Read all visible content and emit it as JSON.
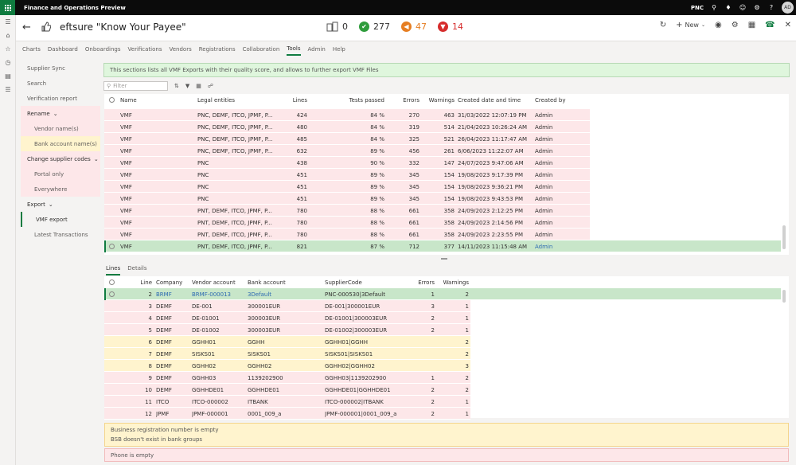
{
  "app": {
    "name": "Finance and Operations Preview",
    "company": "PNC",
    "user_initials": "AD"
  },
  "header": {
    "title": "eftsure \"Know Your Payee\"",
    "new_label": "New"
  },
  "stats": [
    {
      "value": "0",
      "color": "#666666"
    },
    {
      "value": "277",
      "color": "#2e9c3b"
    },
    {
      "value": "47",
      "color": "#e67e22"
    },
    {
      "value": "14",
      "color": "#d62c2c"
    }
  ],
  "tabs": [
    "Charts",
    "Dashboard",
    "Onboardings",
    "Verifications",
    "Vendors",
    "Registrations",
    "Collaboration",
    "Tools",
    "Admin",
    "Help"
  ],
  "active_tab": "Tools",
  "nav": [
    {
      "label": "Supplier Sync",
      "style": "plain"
    },
    {
      "label": "Search",
      "style": "plain"
    },
    {
      "label": "Verification report",
      "style": "plain"
    },
    {
      "label": "Rename",
      "style": "pink-hd"
    },
    {
      "label": "Vendor name(s)",
      "style": "pink-sub"
    },
    {
      "label": "Bank account name(s)",
      "style": "yellow-sub"
    },
    {
      "label": "Change supplier codes",
      "style": "pink-hd"
    },
    {
      "label": "Portal only",
      "style": "pink-sub"
    },
    {
      "label": "Everywhere",
      "style": "pink-sub"
    },
    {
      "label": "Export",
      "style": "hd"
    },
    {
      "label": "VMF export",
      "style": "sel"
    },
    {
      "label": "Latest Transactions",
      "style": "sub"
    }
  ],
  "banner": "This sections lists all VMF Exports with their quality score, and allows to further export VMF Files",
  "filter_placeholder": "Filter",
  "top_grid": {
    "headers": [
      "Name",
      "Legal entities",
      "Lines",
      "Tests passed",
      "Errors",
      "Warnings",
      "Created date and time",
      "Created by"
    ],
    "rows": [
      [
        "VMF",
        "PNC, DEMF, ITCO, JPMF, P...",
        "424",
        "84 %",
        "270",
        "463",
        "31/03/2022 12:07:19 PM",
        "Admin"
      ],
      [
        "VMF",
        "PNC, DEMF, ITCO, JPMF, P...",
        "480",
        "84 %",
        "319",
        "514",
        "21/04/2023 10:26:24 AM",
        "Admin"
      ],
      [
        "VMF",
        "PNC, DEMF, ITCO, JPMF, P...",
        "485",
        "84 %",
        "325",
        "521",
        "26/04/2023 11:17:47 AM",
        "Admin"
      ],
      [
        "VMF",
        "PNC, DEMF, ITCO, JPMF, P...",
        "632",
        "89 %",
        "456",
        "261",
        "6/06/2023 11:22:07 AM",
        "Admin"
      ],
      [
        "VMF",
        "PNC",
        "438",
        "90 %",
        "332",
        "147",
        "24/07/2023 9:47:06 AM",
        "Admin"
      ],
      [
        "VMF",
        "PNC",
        "451",
        "89 %",
        "345",
        "154",
        "19/08/2023 9:17:39 PM",
        "Admin"
      ],
      [
        "VMF",
        "PNC",
        "451",
        "89 %",
        "345",
        "154",
        "19/08/2023 9:36:21 PM",
        "Admin"
      ],
      [
        "VMF",
        "PNC",
        "451",
        "89 %",
        "345",
        "154",
        "19/08/2023 9:43:53 PM",
        "Admin"
      ],
      [
        "VMF",
        "PNT, DEMF, ITCO, JPMF, P...",
        "780",
        "88 %",
        "661",
        "358",
        "24/09/2023 2:12:25 PM",
        "Admin"
      ],
      [
        "VMF",
        "PNT, DEMF, ITCO, JPMF, P...",
        "780",
        "88 %",
        "661",
        "358",
        "24/09/2023 2:14:56 PM",
        "Admin"
      ],
      [
        "VMF",
        "PNT, DEMF, ITCO, JPMF, P...",
        "780",
        "88 %",
        "661",
        "358",
        "24/09/2023 2:23:55 PM",
        "Admin"
      ],
      [
        "VMF",
        "PNT, DEMF, ITCO, JPMF, P...",
        "821",
        "87 %",
        "712",
        "377",
        "14/11/2023 11:15:48 AM",
        "Admin"
      ]
    ]
  },
  "sub_tabs": [
    "Lines",
    "Details"
  ],
  "bottom_grid": {
    "headers": [
      "Line",
      "Company",
      "Vendor account",
      "Bank account",
      "SupplierCode",
      "Errors",
      "Warnings"
    ],
    "rows": [
      {
        "tone": "green",
        "cells": [
          "2",
          "BRMF",
          "BRMF-000013",
          "3Default",
          "PNC-000530|3Default",
          "1",
          "2"
        ]
      },
      {
        "tone": "pink",
        "cells": [
          "3",
          "DEMF",
          "DE-001",
          "300001EUR",
          "DE-001|300001EUR",
          "3",
          "1"
        ]
      },
      {
        "tone": "pink",
        "cells": [
          "4",
          "DEMF",
          "DE-01001",
          "300003EUR",
          "DE-01001|300003EUR",
          "2",
          "1"
        ]
      },
      {
        "tone": "pink",
        "cells": [
          "5",
          "DEMF",
          "DE-01002",
          "300003EUR",
          "DE-01002|300003EUR",
          "2",
          "1"
        ]
      },
      {
        "tone": "yellow",
        "cells": [
          "6",
          "DEMF",
          "GGHH01",
          "GGHH",
          "GGHH01|GGHH",
          "",
          "2"
        ]
      },
      {
        "tone": "yellow",
        "cells": [
          "7",
          "DEMF",
          "SISKS01",
          "SISKS01",
          "SISKS01|SISKS01",
          "",
          "2"
        ]
      },
      {
        "tone": "yellow",
        "cells": [
          "8",
          "DEMF",
          "GGHH02",
          "GGHH02",
          "GGHH02|GGHH02",
          "",
          "3"
        ]
      },
      {
        "tone": "pink",
        "cells": [
          "9",
          "DEMF",
          "GGHH03",
          "1139202900",
          "GGHH03|1139202900",
          "1",
          "2"
        ]
      },
      {
        "tone": "pink",
        "cells": [
          "10",
          "DEMF",
          "GGHHDE01",
          "GGHHDE01",
          "GGHHDE01|GGHHDE01",
          "2",
          "2"
        ]
      },
      {
        "tone": "pink",
        "cells": [
          "11",
          "ITCO",
          "ITCO-000002",
          "ITBANK",
          "ITCO-000002|ITBANK",
          "2",
          "1"
        ]
      },
      {
        "tone": "pink",
        "cells": [
          "12",
          "JPMF",
          "JPMF-000001",
          "0001_009_a",
          "JPMF-000001|0001_009_a",
          "2",
          "1"
        ]
      }
    ]
  },
  "messages": {
    "warnings": [
      "Business registration number is empty",
      "BSB doesn't exist in bank groups"
    ],
    "error": "Phone is empty"
  }
}
